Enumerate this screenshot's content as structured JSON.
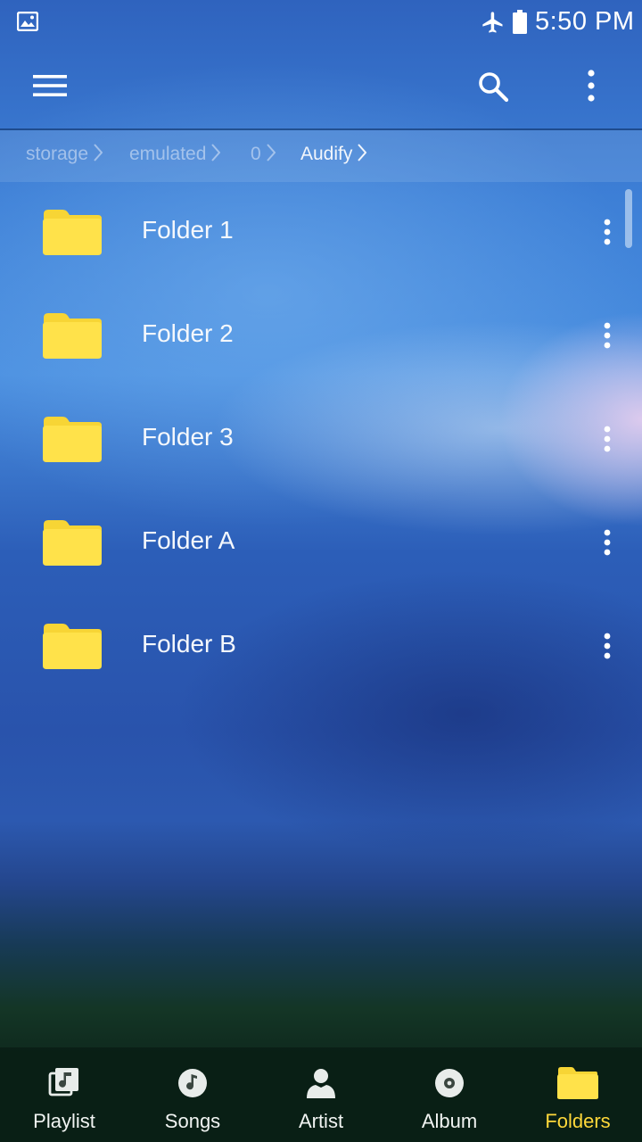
{
  "status_bar": {
    "time": "5:50 PM",
    "icons": [
      "gallery-notification-icon",
      "airplane-mode-icon",
      "battery-icon"
    ]
  },
  "app_bar": {
    "icons": [
      "menu-icon",
      "search-icon",
      "more-vert-icon"
    ]
  },
  "breadcrumb": {
    "items": [
      {
        "label": "storage"
      },
      {
        "label": "emulated"
      },
      {
        "label": "0"
      },
      {
        "label": "Audify"
      }
    ],
    "active_index": 3
  },
  "folders": [
    {
      "name": "Folder 1"
    },
    {
      "name": "Folder 2"
    },
    {
      "name": "Folder 3"
    },
    {
      "name": "Folder A"
    },
    {
      "name": "Folder B"
    }
  ],
  "bottom_nav": {
    "items": [
      {
        "label": "Playlist",
        "icon": "playlist-icon"
      },
      {
        "label": "Songs",
        "icon": "music-note-icon"
      },
      {
        "label": "Artist",
        "icon": "person-icon"
      },
      {
        "label": "Album",
        "icon": "disc-icon"
      },
      {
        "label": "Folders",
        "icon": "folder-icon"
      }
    ],
    "active_index": 4
  },
  "colors": {
    "folder_yellow": "#ffe24a",
    "active_tab": "#ffd83a",
    "text": "#f5f8fc"
  }
}
